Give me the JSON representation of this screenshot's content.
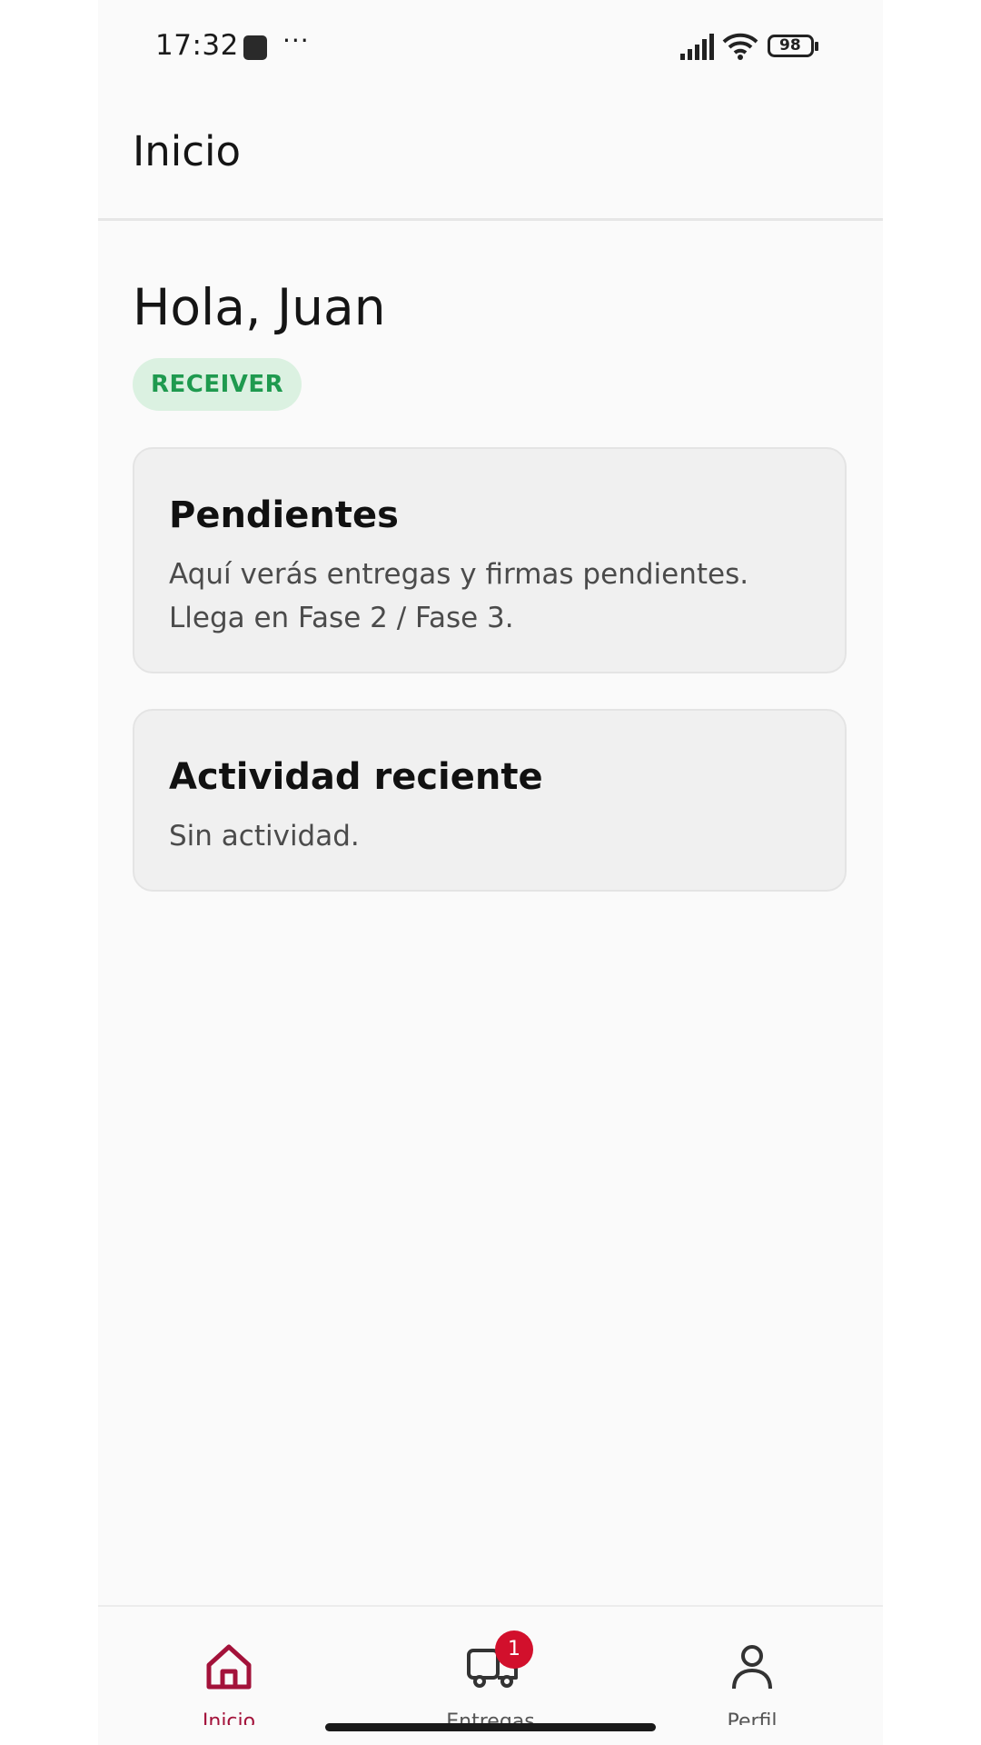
{
  "status_bar": {
    "time": "17:32",
    "more": "···",
    "battery": "98"
  },
  "app_bar": {
    "title": "Inicio"
  },
  "greeting": "Hola, Juan",
  "role_badge": "RECEIVER",
  "cards": [
    {
      "title": "Pendientes",
      "lines": [
        "Aquí verás entregas y firmas pendientes.",
        "Llega en Fase 2 / Fase 3."
      ]
    },
    {
      "title": "Actividad reciente",
      "lines": [
        "Sin actividad."
      ]
    }
  ],
  "bottom_nav": {
    "items": [
      {
        "label": "Inicio",
        "icon": "home-icon",
        "active": true
      },
      {
        "label": "Entregas",
        "icon": "truck-icon",
        "badge": "1"
      },
      {
        "label": "Perfil",
        "icon": "person-icon"
      }
    ]
  },
  "colors": {
    "accent": "#a3123a",
    "badge_bg": "#dbf1e1",
    "badge_text": "#1f9a4f",
    "notification": "#d2102c"
  }
}
